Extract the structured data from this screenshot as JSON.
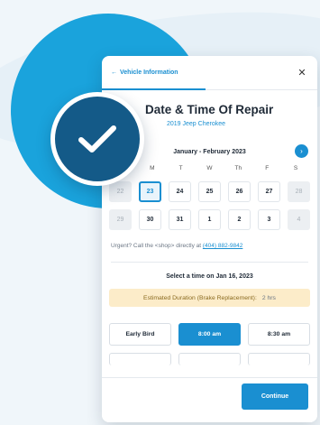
{
  "header": {
    "back_label": "Vehicle Information",
    "back_icon": "chevron-left-icon",
    "close_glyph": "✕"
  },
  "title": {
    "text": "Date & Time Of Repair",
    "vehicle": "2019 Jeep Cherokee"
  },
  "calendar": {
    "month_label": "January - February 2023",
    "next_glyph": "›",
    "weekdays": [
      "S",
      "M",
      "T",
      "W",
      "Th",
      "F",
      "S"
    ],
    "days": [
      {
        "label": "22",
        "state": "muted"
      },
      {
        "label": "23",
        "state": "selected"
      },
      {
        "label": "24",
        "state": "normal"
      },
      {
        "label": "25",
        "state": "normal"
      },
      {
        "label": "26",
        "state": "normal"
      },
      {
        "label": "27",
        "state": "normal"
      },
      {
        "label": "28",
        "state": "muted"
      },
      {
        "label": "29",
        "state": "muted"
      },
      {
        "label": "30",
        "state": "normal"
      },
      {
        "label": "31",
        "state": "normal"
      },
      {
        "label": "1",
        "state": "normal"
      },
      {
        "label": "2",
        "state": "normal"
      },
      {
        "label": "3",
        "state": "normal"
      },
      {
        "label": "4",
        "state": "muted"
      }
    ]
  },
  "urgent": {
    "text": "Urgent? Call the <shop> directly at ",
    "phone": "(404) 882-9842"
  },
  "times": {
    "title": "Select a time on Jan 16, 2023",
    "duration_label": "Estimated Duration (Brake Replacement):",
    "duration_value": "2 hrs",
    "slots": [
      {
        "label": "Early Bird",
        "active": false
      },
      {
        "label": "8:00 am",
        "active": true
      },
      {
        "label": "8:30 am",
        "active": false
      }
    ]
  },
  "footer": {
    "continue_label": "Continue"
  },
  "colors": {
    "accent": "#1a8fd1",
    "circle": "#1aa3dc",
    "badge": "#145a88",
    "duration_bg": "#fcecc9"
  }
}
